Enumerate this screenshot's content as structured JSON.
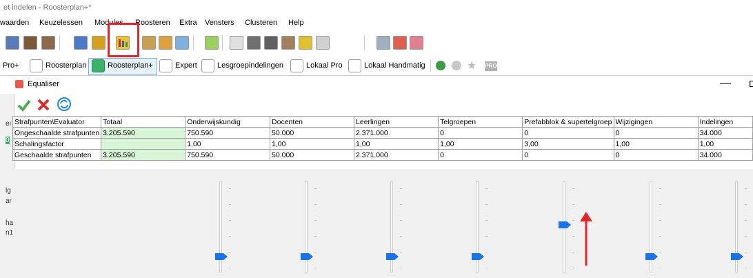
{
  "window": {
    "title": "et indelen - Roosterplan+*"
  },
  "menu": [
    "waarden",
    "Keuzelessen",
    "Modules",
    "Roosteren",
    "Extra",
    "Vensters",
    "Clusteren",
    "Help"
  ],
  "modes": [
    {
      "label": "Pro+",
      "checked": false
    },
    {
      "label": "Roosterplan",
      "checked": false
    },
    {
      "label": "Roosterplan+",
      "checked": true
    },
    {
      "label": "Expert",
      "checked": false
    },
    {
      "label": "Lesgroepindelingen",
      "checked": false
    },
    {
      "label": "Lokaal Pro",
      "checked": false
    },
    {
      "label": "Lokaal Handmatig",
      "checked": false
    }
  ],
  "badge": {
    "label": "PRO"
  },
  "colors": {
    "accent_red": "#e0262a",
    "check_green": "#3bb26a",
    "thumb_blue": "#1a73e8",
    "cell_green": "#d8f5d8"
  },
  "equaliser": {
    "title": "Equaliser",
    "minimize": "—",
    "restore": "D",
    "toolbar": {
      "ok_icon": "checkmark-icon",
      "cancel_icon": "x-icon",
      "refresh_icon": "refresh-icon"
    },
    "table": {
      "headers": [
        "Strafpunten\\Evaluator",
        "Totaal",
        "Onderwijskundig",
        "Docenten",
        "Leerlingen",
        "Telgroepen",
        "Prefabblok & supertelgroep",
        "Wijzigingen",
        "Indelingen"
      ],
      "rows": [
        {
          "cells": [
            "Ongeschaalde strafpunten",
            "3.205.590",
            "750.590",
            "50.000",
            "2.371.000",
            "0",
            "0",
            "0",
            "34.000"
          ]
        },
        {
          "cells": [
            "Schalingsfactor",
            "",
            "1,00",
            "1,00",
            "1,00",
            "1,00",
            "3,00",
            "1,00",
            "1,00"
          ]
        },
        {
          "cells": [
            "Geschaalde strafpunten",
            "3.205.590",
            "750.590",
            "50.000",
            "2.371.000",
            "0",
            "0",
            "0",
            "34.000"
          ]
        }
      ]
    },
    "sliders": [
      {
        "name": "Onderwijskundig",
        "level": 0.0
      },
      {
        "name": "Docenten",
        "level": 0.0
      },
      {
        "name": "Leerlingen",
        "level": 0.0
      },
      {
        "name": "Telgroepen",
        "level": 0.0
      },
      {
        "name": "Prefabblok & supertelgroep",
        "level": 0.45
      },
      {
        "name": "Wijzigingen",
        "level": 0.0
      },
      {
        "name": "Indelingen",
        "level": 0.0
      }
    ]
  },
  "left_strip": [
    "eı",
    "0",
    "lg",
    "ar",
    "ha",
    "n1"
  ]
}
